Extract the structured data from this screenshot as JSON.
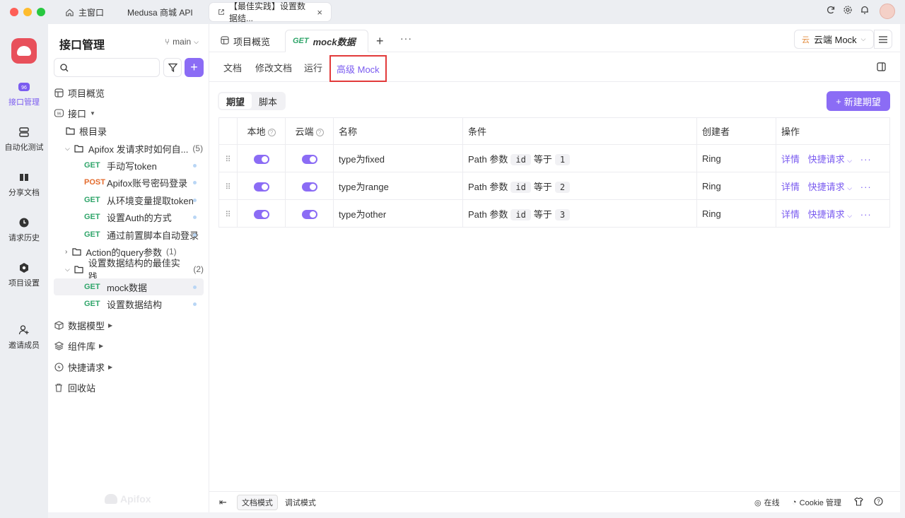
{
  "window": {
    "tabs": [
      {
        "label": "主窗口"
      },
      {
        "label": "Medusa 商城 API"
      },
      {
        "label": "【最佳实践】设置数据结..."
      }
    ]
  },
  "rail": {
    "items": [
      {
        "label": "接口管理",
        "icon": "api-icon"
      },
      {
        "label": "自动化测试",
        "icon": "automation-icon"
      },
      {
        "label": "分享文档",
        "icon": "book-icon"
      },
      {
        "label": "请求历史",
        "icon": "history-icon"
      },
      {
        "label": "项目设置",
        "icon": "settings-icon"
      },
      {
        "label": "邀请成员",
        "icon": "invite-icon"
      }
    ]
  },
  "sidebar": {
    "title": "接口管理",
    "branch": "main",
    "search_placeholder": "",
    "tree": {
      "overview": "项目概览",
      "interfaces": "接口",
      "root": "根目录",
      "folder1": {
        "name": "Apifox 发请求时如何自...",
        "count": "(5)"
      },
      "folder1_items": [
        {
          "method": "GET",
          "name": "手动写token"
        },
        {
          "method": "POST",
          "name": "Apifox账号密码登录"
        },
        {
          "method": "GET",
          "name": "从环境变量提取token"
        },
        {
          "method": "GET",
          "name": "设置Auth的方式"
        },
        {
          "method": "GET",
          "name": "通过前置脚本自动登录"
        }
      ],
      "folder2": {
        "name": "Action的query参数",
        "count": "(1)"
      },
      "folder3": {
        "name": "设置数据结构的最佳实践",
        "count": "(2)"
      },
      "folder3_items": [
        {
          "method": "GET",
          "name": "mock数据"
        },
        {
          "method": "GET",
          "name": "设置数据结构"
        }
      ],
      "models": "数据模型",
      "components": "组件库",
      "quick": "快捷请求",
      "trash": "回收站"
    },
    "watermark": "Apifox"
  },
  "main": {
    "tabs": {
      "overview": "项目概览",
      "mock_method": "GET",
      "mock_name": "mock数据"
    },
    "env": {
      "badge": "云",
      "label": "云端 Mock"
    },
    "subtabs": [
      "文档",
      "修改文档",
      "运行",
      "高级 Mock"
    ],
    "segments": [
      "期望",
      "脚本"
    ],
    "new_button": "新建期望",
    "table": {
      "headers": [
        "本地",
        "云端",
        "名称",
        "条件",
        "创建者",
        "操作"
      ],
      "rows": [
        {
          "name": "type为fixed",
          "cond_prefix": "Path 参数",
          "param": "id",
          "op": "等于",
          "value": "1",
          "creator": "Ring"
        },
        {
          "name": "type为range",
          "cond_prefix": "Path 参数",
          "param": "id",
          "op": "等于",
          "value": "2",
          "creator": "Ring"
        },
        {
          "name": "type为other",
          "cond_prefix": "Path 参数",
          "param": "id",
          "op": "等于",
          "value": "3",
          "creator": "Ring"
        }
      ],
      "actions": {
        "detail": "详情",
        "quick": "快捷请求",
        "more": "···"
      }
    },
    "footer": {
      "doc_mode": "文档模式",
      "debug_mode": "调试模式",
      "online": "在线",
      "cookie": "Cookie 管理"
    }
  },
  "colors": {
    "accent": "#8b6cf5",
    "get": "#2fa56a",
    "post": "#e36b2d",
    "highlight": "#e23a3a"
  }
}
